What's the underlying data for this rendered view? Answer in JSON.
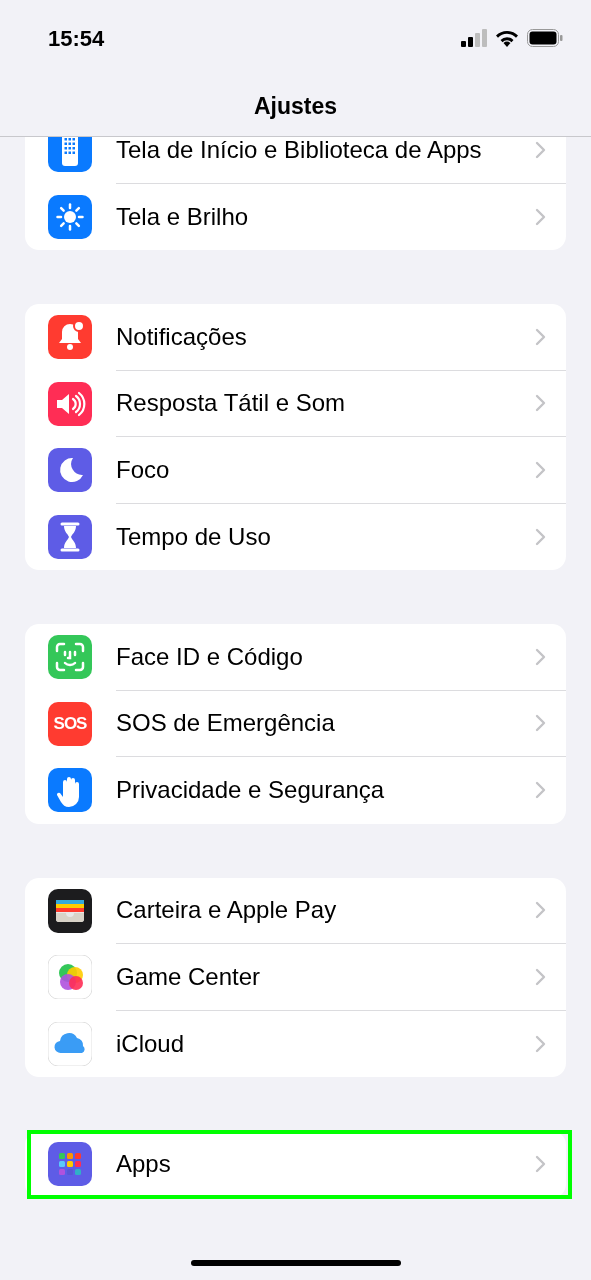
{
  "status_bar": {
    "time": "15:54"
  },
  "title": "Ajustes",
  "groups": [
    {
      "items": [
        {
          "label": "Tela de Início e Biblioteca de Apps",
          "kind": "home-screen"
        },
        {
          "label": "Tela e Brilho",
          "kind": "display"
        }
      ]
    },
    {
      "items": [
        {
          "label": "Notificações",
          "kind": "notifications"
        },
        {
          "label": "Resposta Tátil e Som",
          "kind": "sounds"
        },
        {
          "label": "Foco",
          "kind": "focus"
        },
        {
          "label": "Tempo de Uso",
          "kind": "screen-time"
        }
      ]
    },
    {
      "items": [
        {
          "label": "Face ID e Código",
          "kind": "face-id"
        },
        {
          "label": "SOS de Emergência",
          "kind": "sos",
          "icon_text": "SOS"
        },
        {
          "label": "Privacidade e Segurança",
          "kind": "privacy"
        }
      ]
    },
    {
      "items": [
        {
          "label": "Carteira e Apple Pay",
          "kind": "wallet"
        },
        {
          "label": "Game Center",
          "kind": "game-center"
        },
        {
          "label": "iCloud",
          "kind": "icloud"
        }
      ]
    },
    {
      "items": [
        {
          "label": "Apps",
          "kind": "apps",
          "highlighted": true
        }
      ]
    }
  ]
}
